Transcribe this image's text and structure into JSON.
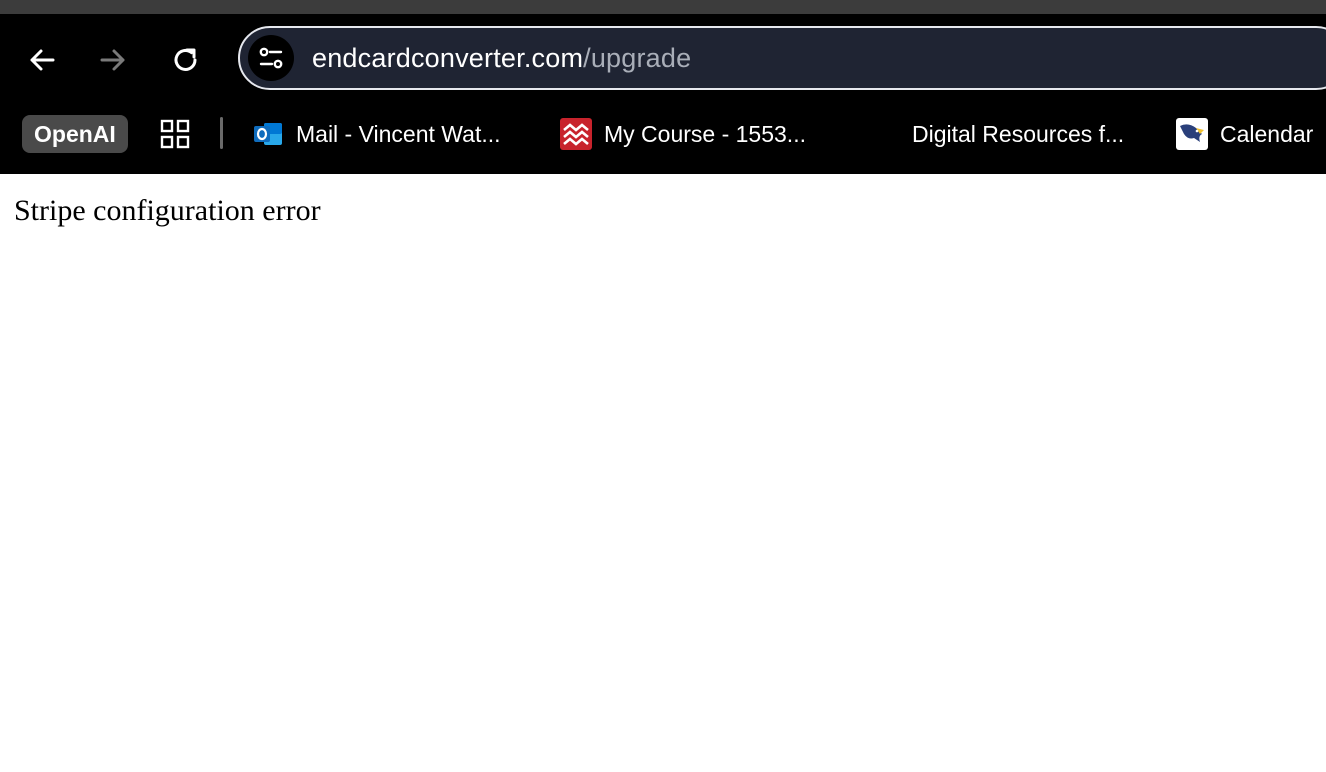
{
  "browser": {
    "url_host": "endcardconverter.com",
    "url_path": "/upgrade",
    "nav": {
      "back_icon": "arrow-left-icon",
      "forward_icon": "arrow-right-icon",
      "reload_icon": "reload-icon",
      "site_info_icon": "tune-icon"
    },
    "bookmarks": [
      {
        "label": "OpenAI",
        "style": "chip"
      },
      {
        "label": "apps",
        "icon": "apps-grid-icon"
      },
      {
        "label": "Mail - Vincent Wat...",
        "icon": "outlook-icon",
        "color": "#0f6cbd"
      },
      {
        "label": "My Course - 1553...",
        "icon": "course-logo-icon",
        "color": "#c8232c"
      },
      {
        "label": "Digital Resources f...",
        "icon": ""
      },
      {
        "label": "Calendar",
        "icon": "eagle-logo-icon"
      }
    ]
  },
  "page": {
    "message": "Stripe configuration error"
  },
  "colors": {
    "chrome_bg": "#000000",
    "omnibox_bg": "#1f2433",
    "omnibox_border": "#e6e8ee",
    "url_path": "#a9aeb8"
  }
}
